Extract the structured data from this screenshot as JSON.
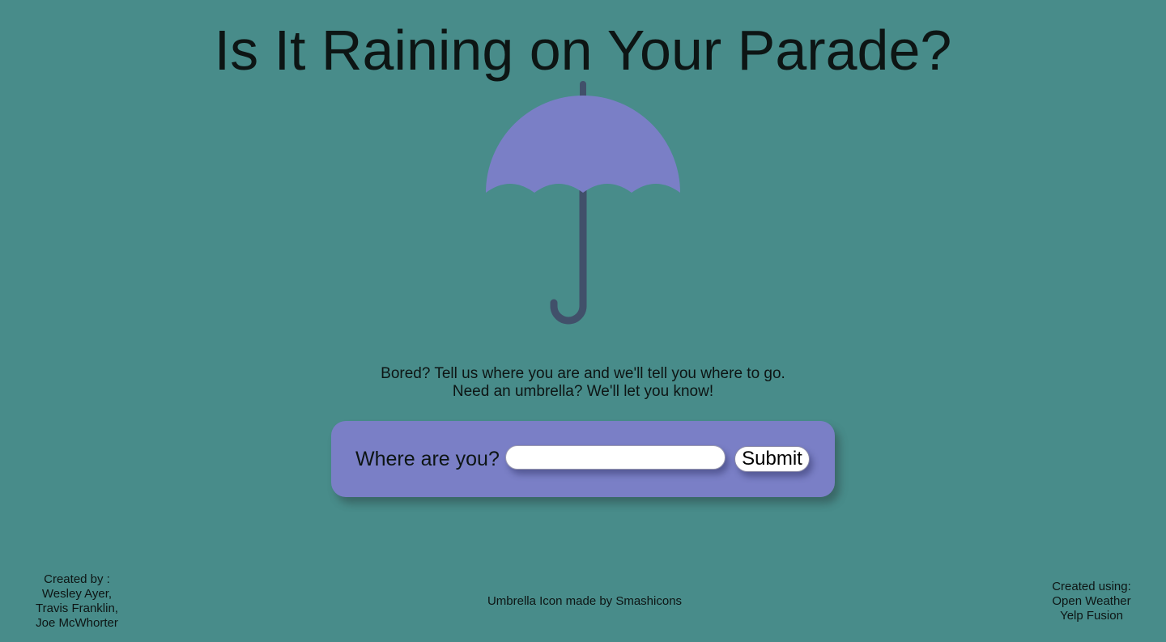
{
  "header": {
    "title": "Is It Raining on Your Parade?"
  },
  "hero": {
    "icon": "umbrella-icon",
    "icon_canopy_color": "#7a7fc6",
    "icon_handle_color": "#41506a"
  },
  "tagline": {
    "line1": "Bored? Tell us where you are and we'll tell you where to go.",
    "line2": "Need an umbrella? We'll let you know!"
  },
  "search": {
    "label": "Where are you?",
    "value": "",
    "placeholder": "",
    "submit_label": "Submit",
    "card_color": "#7a7fc6"
  },
  "footer": {
    "credits_heading": "Created by :",
    "credits": [
      "Wesley Ayer,",
      "Travis Franklin,",
      "Joe McWhorter"
    ],
    "icon_credit": "Umbrella Icon made by Smashicons",
    "tools_heading": "Created using:",
    "tools": [
      "Open Weather",
      "Yelp Fusion"
    ]
  },
  "colors": {
    "background": "#488c8a",
    "text": "#0d1514"
  }
}
